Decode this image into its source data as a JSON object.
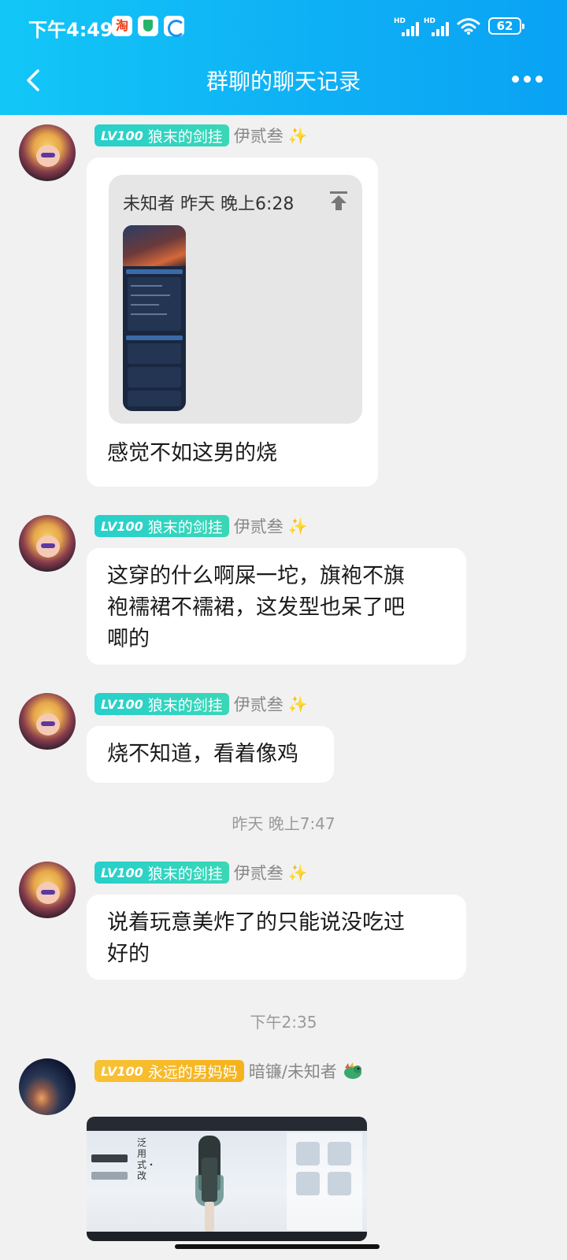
{
  "status_bar": {
    "time": "下午4:49",
    "taobao_icon_text": "淘",
    "signal_1": "HD",
    "signal_2": "HD",
    "battery": "62"
  },
  "nav": {
    "title": "群聊的聊天记录"
  },
  "badges": {
    "level": "LV100",
    "title_1": "狼末的剑挂",
    "title_2": "永远的男妈妈"
  },
  "messages": [
    {
      "sender": "伊贰叁",
      "forward_header": "未知者  昨天 晚上6:28",
      "text": "感觉不如这男的烧"
    },
    {
      "sender": "伊贰叁",
      "text_line1": "这穿的什么啊屎一坨，旗袍不旗",
      "text_line2": "袍襦裙不襦裙，这发型也呆了吧",
      "text_line3": "唧的"
    },
    {
      "sender": "伊贰叁",
      "text": "烧不知道，看着像鸡"
    },
    {
      "sender": "伊贰叁",
      "text_line1": "说着玩意美炸了的只能说没吃过",
      "text_line2": "好的"
    },
    {
      "sender": "暗镰/未知者"
    }
  ],
  "timestamps": {
    "t1": "昨天 晚上7:47",
    "t2": "下午2:35"
  },
  "screenshot_thumb": {
    "vertical_text": "泛用式・改"
  },
  "icons": [
    "back-icon",
    "more-icon",
    "sparkle-icon",
    "pin-icon",
    "dragon-icon",
    "wifi-icon",
    "battery-icon"
  ],
  "colors": {
    "header_start": "#12c7f7",
    "header_end": "#0aa2f4",
    "badge_teal": "#26d0cc",
    "badge_gold": "#f8c236",
    "background": "#f1f1f1"
  }
}
